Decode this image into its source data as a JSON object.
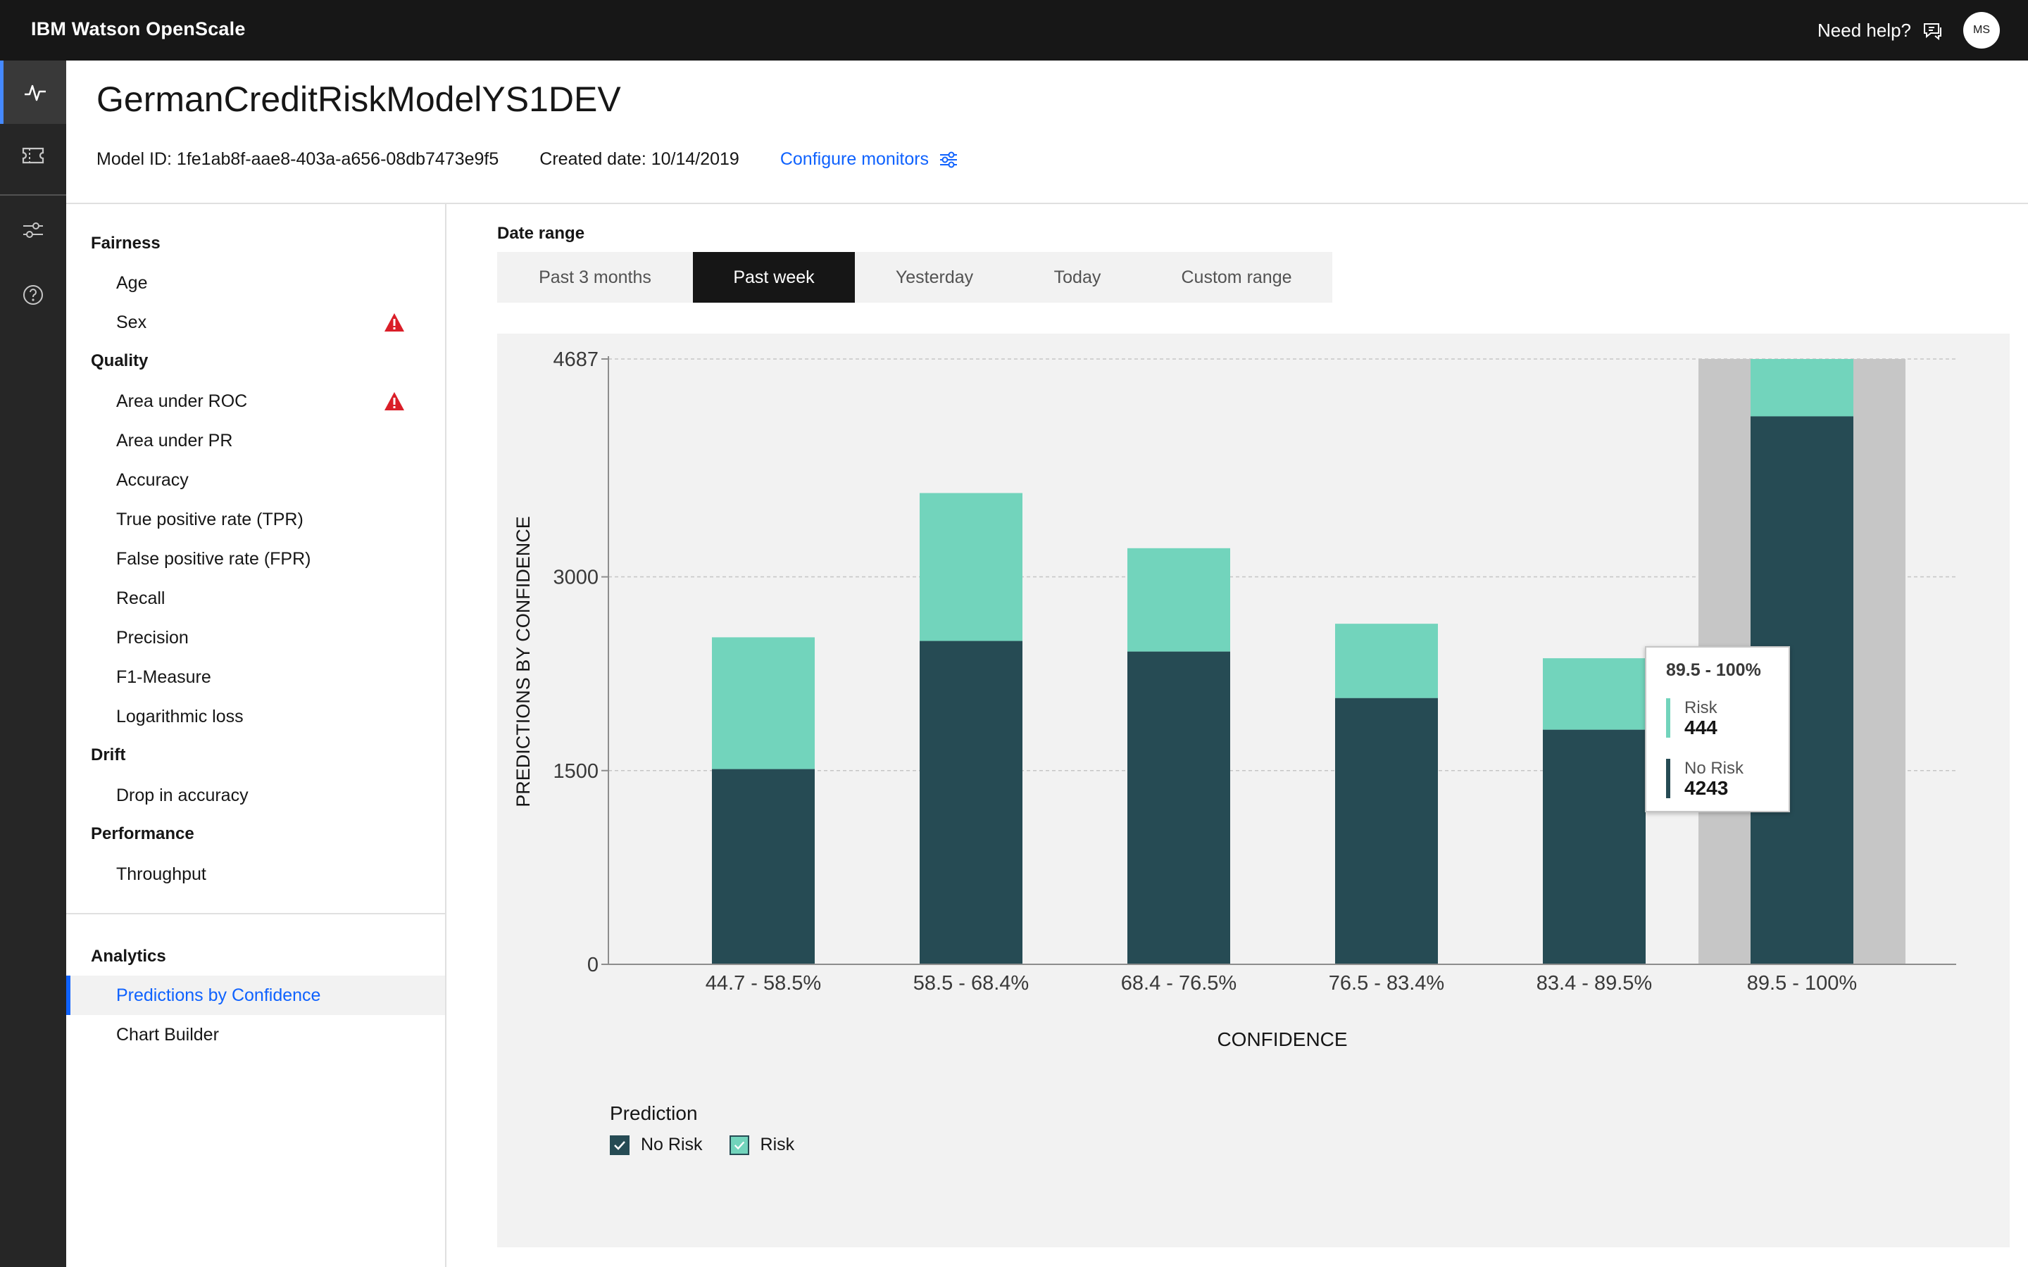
{
  "app": {
    "title": "IBM Watson OpenScale",
    "help_label": "Need help?",
    "user_initials": "MS"
  },
  "header": {
    "model_name": "GermanCreditRiskModelYS1DEV",
    "model_id": "Model ID: 1fe1ab8f-aae8-403a-a656-08db7473e9f5",
    "created": "Created date: 10/14/2019",
    "configure_label": "Configure monitors"
  },
  "nav": {
    "fairness": "Fairness",
    "age": "Age",
    "sex": "Sex",
    "quality": "Quality",
    "auroc": "Area under ROC",
    "aupr": "Area under PR",
    "accuracy": "Accuracy",
    "tpr": "True positive rate (TPR)",
    "fpr": "False positive rate (FPR)",
    "recall": "Recall",
    "precision": "Precision",
    "f1": "F1-Measure",
    "logloss": "Logarithmic loss",
    "drift": "Drift",
    "drop": "Drop in accuracy",
    "performance": "Performance",
    "throughput": "Throughput",
    "analytics": "Analytics",
    "predictions": "Predictions by Confidence",
    "chart_builder": "Chart Builder"
  },
  "date_range": {
    "label": "Date range",
    "tabs": [
      "Past 3 months",
      "Past week",
      "Yesterday",
      "Today",
      "Custom range"
    ],
    "selected": "Past week"
  },
  "tooltip": {
    "title": "89.5 - 100%",
    "risk_label": "Risk",
    "risk_value": "444",
    "norisk_label": "No Risk",
    "norisk_value": "4243"
  },
  "legend": {
    "title": "Prediction",
    "norisk": "No Risk",
    "risk": "Risk"
  },
  "colors": {
    "no_risk": "#264b54",
    "risk": "#72d4bc",
    "accent": "#0f62fe",
    "warning": "#da1e28"
  },
  "chart_data": {
    "type": "bar",
    "stacked": true,
    "categories": [
      "44.7 - 58.5%",
      "58.5 - 68.4%",
      "68.4 - 76.5%",
      "76.5 - 83.4%",
      "83.4 - 89.5%",
      "89.5 - 100%"
    ],
    "series": [
      {
        "name": "No Risk",
        "values": [
          1512,
          2504,
          2422,
          2062,
          1817,
          4243
        ]
      },
      {
        "name": "Risk",
        "values": [
          1020,
          1145,
          800,
          575,
          553,
          444
        ]
      }
    ],
    "xlabel": "CONFIDENCE",
    "ylabel": "PREDICTIONS BY CONFIDENCE",
    "yticks": [
      0,
      1500,
      3000,
      4687
    ],
    "ylim": [
      0,
      4687
    ],
    "grid": true,
    "highlighted_category": "89.5 - 100%",
    "legend_title": "Prediction"
  }
}
